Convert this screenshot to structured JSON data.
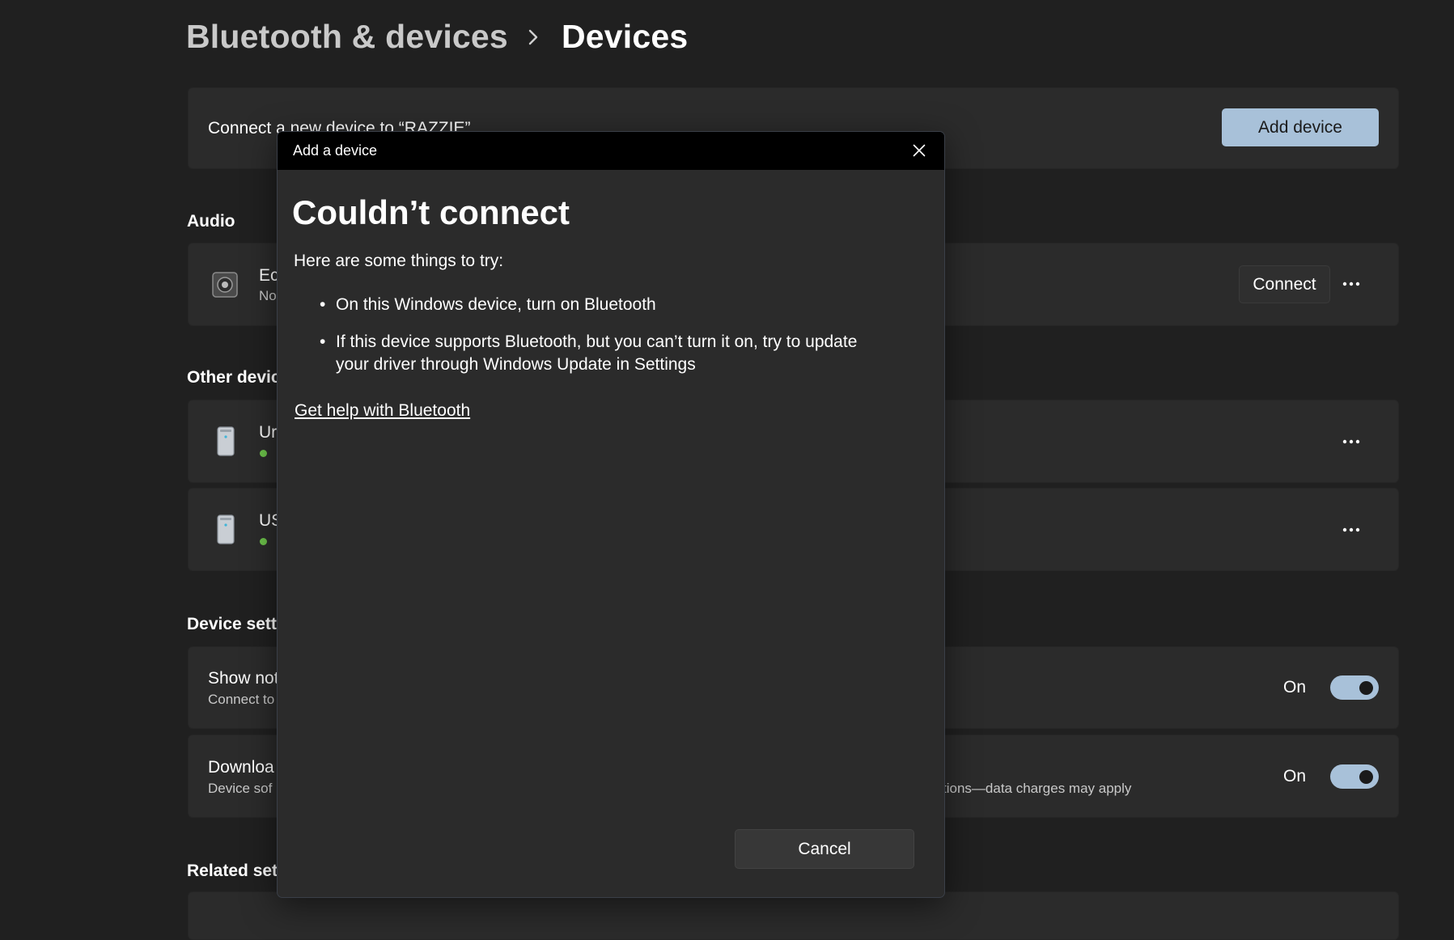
{
  "breadcrumb": {
    "parent": "Bluetooth & devices",
    "current": "Devices"
  },
  "connect_card": {
    "title": "Connect a new device to “RAZZIE”",
    "button": "Add device"
  },
  "audio_section": {
    "title": "Audio",
    "device": {
      "name": "Ec",
      "status": "No",
      "connect_button": "Connect"
    }
  },
  "other_devices": {
    "title": "Other devic",
    "items": [
      {
        "name": "Ur"
      },
      {
        "name": "US"
      }
    ]
  },
  "device_settings": {
    "title": "Device setti",
    "items": [
      {
        "title": "Show not",
        "subtitle": "Connect to",
        "toggle_label": "On"
      },
      {
        "title": "Downloa",
        "subtitle": "Device sof",
        "subtitle_tail": "tions—data charges may apply",
        "toggle_label": "On"
      }
    ]
  },
  "related_section": {
    "title": "Related sett"
  },
  "dialog": {
    "window_title": "Add a device",
    "heading": "Couldn’t connect",
    "intro": "Here are some things to try:",
    "tips": [
      "On this Windows device, turn on Bluetooth",
      "If this device supports Bluetooth, but you can’t turn it on, try to update your driver through Windows Update in Settings"
    ],
    "help_link": "Get help with Bluetooth",
    "cancel_button": "Cancel"
  },
  "colors": {
    "background": "#202020",
    "card": "#2b2b2b",
    "accent": "#a8c1d9",
    "status_green": "#6cc24a",
    "dialog_titlebar": "#000000"
  },
  "icons": [
    "chevron-right-icon",
    "speaker-icon",
    "usb-device-icon",
    "more-icon",
    "close-icon"
  ]
}
